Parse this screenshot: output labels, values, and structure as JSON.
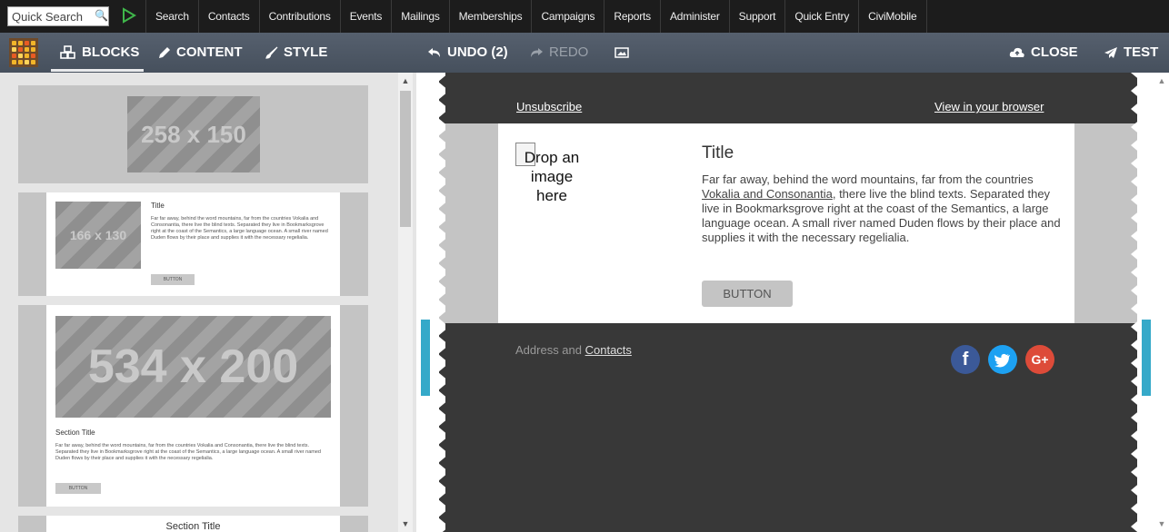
{
  "topbar": {
    "quick_search_placeholder": "Quick Search",
    "menu": [
      "Search",
      "Contacts",
      "Contributions",
      "Events",
      "Mailings",
      "Memberships",
      "Campaigns",
      "Reports",
      "Administer",
      "Support",
      "Quick Entry",
      "CiviMobile"
    ]
  },
  "toolbar": {
    "blocks": "BLOCKS",
    "content": "CONTENT",
    "style": "STYLE",
    "undo": "UNDO (2)",
    "redo": "REDO",
    "close": "CLOSE",
    "test": "TEST"
  },
  "blocks_panel": {
    "block1_placeholder": "258 x 150",
    "block2_placeholder": "166 x 130",
    "block2_title": "Title",
    "block2_text": "Far far away, behind the word mountains, far from the countries Vokalia and Consonantia, there live the blind texts. Separated they live in Bookmarksgrove right at the coast of the Semantics, a large language ocean. A small river named Duden flows by their place and supplies it with the necessary regelialia.",
    "block2_button": "BUTTON",
    "block3_placeholder": "534 x 200",
    "block3_title": "Section Title",
    "block3_text": "Far far away, behind the word mountains, far from the countries Vokalia and Consonantia, there live the blind texts. Separated they live in Bookmarksgrove right at the coast of the Semantics, a large language ocean. A small river named Duden flows by their place and supplies it with the necessary regelialia.",
    "block3_button": "BUTTON",
    "block4_title": "Section Title"
  },
  "email": {
    "unsubscribe": "Unsubscribe",
    "view_in_browser": "View in your browser",
    "drop_image": "Drop an image here",
    "title": "Title",
    "text_before_link": "Far far away, behind the word mountains, far from the countries ",
    "text_link": "Vokalia and Consonantia",
    "text_after_link": ", there live the blind texts. Separated they live in Bookmarksgrove right at the coast of the Semantics, a large language ocean. A small river named Duden flows by their place and supplies it with the necessary regelialia.",
    "button": "BUTTON",
    "address_prefix": "Address and ",
    "address_link": "Contacts",
    "social": {
      "facebook": "f",
      "twitter": "t",
      "googleplus": "G+"
    }
  },
  "colors": {
    "topbar": "#1c1c1c",
    "toolbar": "#4b5563",
    "email_dark": "#383838",
    "selection": "#35a9c9"
  }
}
